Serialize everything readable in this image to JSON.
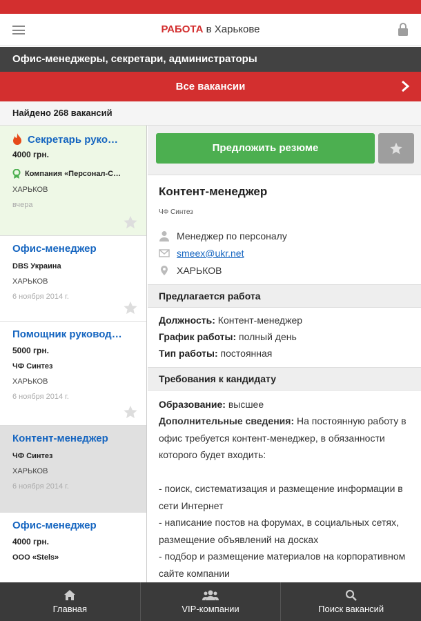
{
  "header": {
    "brand_accent": "РАБОТА",
    "brand_rest": " в Харькове",
    "menu_icon": "hamburger-icon",
    "lock_icon": "lock-icon"
  },
  "category": "Офис-менеджеры, секретари, администраторы",
  "all_vacancies": "Все вакансии",
  "found": "Найдено 268 вакансий",
  "vacancies": [
    {
      "title": "Секретарь руководителя",
      "salary": "4000 грн.",
      "company": "Компания «Персонал-Сервис»",
      "city": "ХАРЬКОВ",
      "date": "вчера",
      "hot": true
    },
    {
      "title": "Офис-менеджер",
      "salary": "",
      "company": "DBS Украина",
      "city": "ХАРЬКОВ",
      "date": "6 ноября 2014 г."
    },
    {
      "title": "Помощник руководителя",
      "salary": "5000 грн.",
      "company": "ЧФ Синтез",
      "city": "ХАРЬКОВ",
      "date": "6 ноября 2014 г."
    },
    {
      "title": "Контент-менеджер",
      "salary": "",
      "company": "ЧФ Синтез",
      "city": "ХАРЬКОВ",
      "date": "6 ноября 2014 г.",
      "selected": true
    },
    {
      "title": "Офис-менеджер",
      "salary": "4000 грн.",
      "company": "ООО «Stels»",
      "city": "",
      "date": ""
    }
  ],
  "detail": {
    "resume_button": "Предложить резюме",
    "title": "Контент-менеджер",
    "company": "ЧФ Синтез",
    "contact_person": "Менеджер по персоналу",
    "email": "smeex@ukr.net",
    "city": "ХАРЬКОВ",
    "section_offer": "Предлагается работа",
    "position_label": "Должность:",
    "position_value": " Контент-менеджер",
    "schedule_label": "График работы:",
    "schedule_value": " полный день",
    "type_label": "Тип работы:",
    "type_value": " постоянная",
    "section_req": "Требования к кандидату",
    "education_label": "Образование:",
    "education_value": " высшее",
    "extra_label": "Дополнительные сведения:",
    "extra_value": " На постоянную работу в офис требуется контент-менеджер, в обязанности которого будет входить:\n\n- поиск, систематизация и размещение информации в сети Интернет\n- написание постов на форумах, в социальных сетях, размещение объявлений на досках\n- подбор и размещение материалов на корпоративном сайте компании"
  },
  "nav": {
    "home": "Главная",
    "vip": "VIP-компании",
    "search": "Поиск вакансий"
  },
  "colors": {
    "red": "#d32f2f",
    "green": "#4caf50",
    "link": "#1565c0",
    "dark": "#3a3a3a"
  }
}
